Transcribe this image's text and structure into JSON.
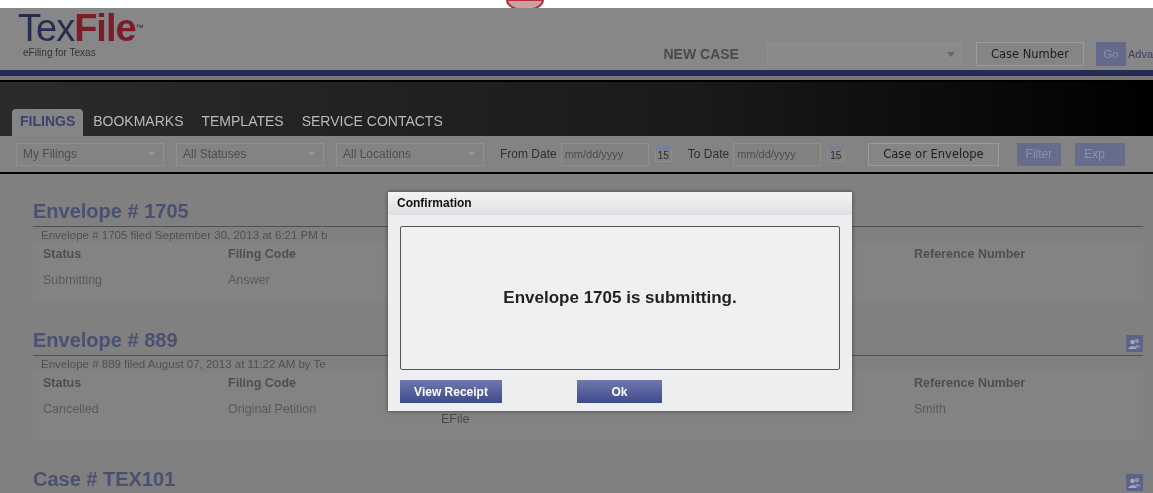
{
  "header": {
    "logo_dark": "Tex",
    "logo_red": "File",
    "logo_mark": "™",
    "tagline": "eFiling for Texas",
    "new_case": "NEW CASE",
    "case_number_button": "Case Number",
    "go_button": "Go",
    "advanced_link": "Adva"
  },
  "tabs": [
    {
      "label": "FILINGS",
      "selected": true
    },
    {
      "label": "BOOKMARKS",
      "selected": false
    },
    {
      "label": "TEMPLATES",
      "selected": false
    },
    {
      "label": "SERVICE CONTACTS",
      "selected": false
    }
  ],
  "filters": {
    "selects": [
      "My Filings",
      "All Statuses",
      "All Locations"
    ],
    "from_label": "From Date",
    "from_placeholder": "mm/dd/yyyy",
    "to_label": "To Date",
    "to_placeholder": "mm/dd/yyyy",
    "from_calendar_day": "15",
    "to_calendar_day": "15",
    "search_button": "Case or Envelope",
    "filter_button": "Filter",
    "export_button": "Exp"
  },
  "sections": [
    {
      "title": "Envelope # 1705",
      "description": "Envelope # 1705 filed September 30, 2013 at 6:21 PM b",
      "contacts_icon": false,
      "status": {
        "label": "Status",
        "value": "Submitting"
      },
      "filing_code": {
        "label": "Filing Code",
        "value": "Answer"
      },
      "reference_number": {
        "label": "Reference Number"
      }
    },
    {
      "title": "Envelope # 889",
      "description": "Envelope # 889 filed August 07, 2013 at 11:22 AM by Te",
      "contacts_icon": true,
      "status": {
        "label": "Status",
        "value": "Cancelled"
      },
      "filing_code": {
        "label": "Filing Code",
        "value": "Original Petition"
      },
      "column_3": {
        "value": "EFile"
      },
      "reference_number": {
        "label": "Reference Number",
        "value": "Smith"
      }
    },
    {
      "title": "Case # TEX101",
      "contacts_icon": true
    }
  ],
  "dialog": {
    "title": "Confirmation",
    "message": "Envelope 1705 is submitting.",
    "buttons": [
      "View Receipt",
      "Ok"
    ]
  }
}
